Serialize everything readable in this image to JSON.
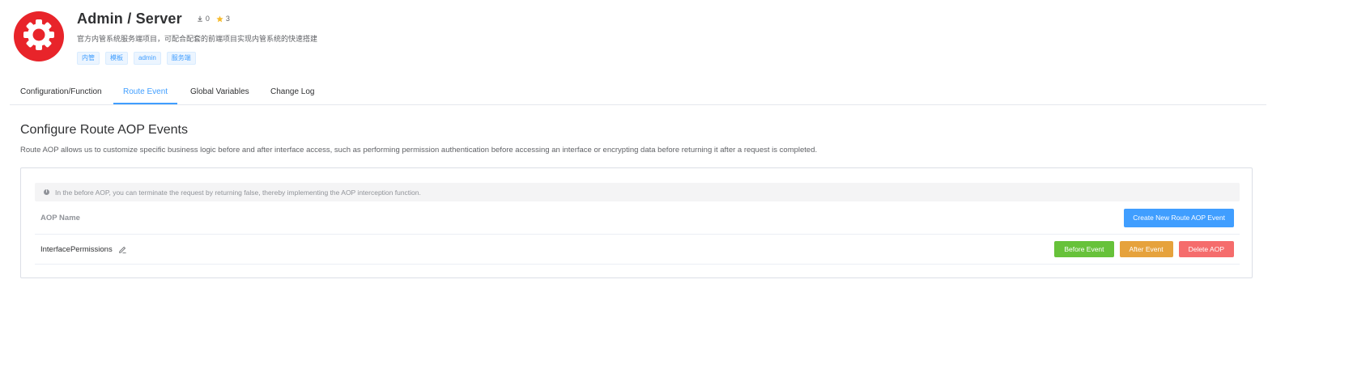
{
  "app": {
    "title": "Admin / Server",
    "downloads": "0",
    "stars": "3",
    "description": "官方内管系统服务端项目，可配合配套的前端项目实现内管系统的快速搭建",
    "tags": [
      "内管",
      "模板",
      "admin",
      "服务端"
    ],
    "logo_icon": "gear-icon",
    "brand_color": "#e8242a"
  },
  "tabs": [
    {
      "label": "Configuration/Function",
      "active": false
    },
    {
      "label": "Route Event",
      "active": true
    },
    {
      "label": "Global Variables",
      "active": false
    },
    {
      "label": "Change Log",
      "active": false
    }
  ],
  "section": {
    "title": "Configure Route AOP Events",
    "description": "Route AOP allows us to customize specific business logic before and after interface access, such as performing permission authentication before accessing an interface or encrypting data before returning it after a request is completed."
  },
  "panel": {
    "alert": "In the before AOP, you can terminate the request by returning false, thereby implementing the AOP interception function.",
    "column_header": "AOP Name",
    "create_button": "Create New Route AOP Event",
    "rows": [
      {
        "name": "InterfacePermissions",
        "before_button": "Before Event",
        "after_button": "After Event",
        "delete_button": "Delete AOP"
      }
    ]
  },
  "colors": {
    "primary": "#409eff",
    "success": "#67c23a",
    "warning": "#e6a23c",
    "danger": "#f56c6c"
  }
}
